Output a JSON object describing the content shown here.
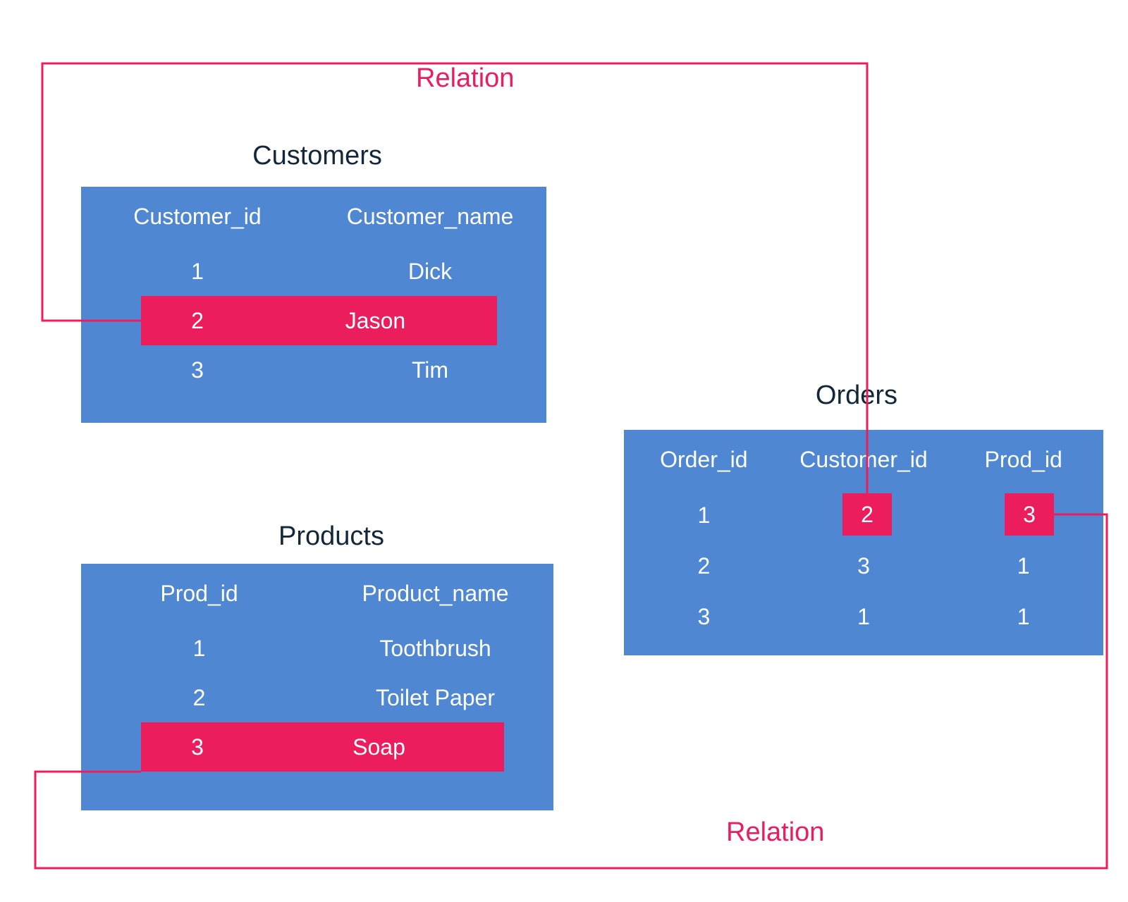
{
  "labels": {
    "relation_top": "Relation",
    "relation_bottom": "Relation"
  },
  "tables": {
    "customers": {
      "title": "Customers",
      "headers": [
        "Customer_id",
        "Customer_name"
      ],
      "rows": [
        {
          "id": "1",
          "name": "Dick"
        },
        {
          "id": "2",
          "name": "Jason"
        },
        {
          "id": "3",
          "name": "Tim"
        }
      ],
      "highlight_row_index": 1
    },
    "products": {
      "title": "Products",
      "headers": [
        "Prod_id",
        "Product_name"
      ],
      "rows": [
        {
          "id": "1",
          "name": "Toothbrush"
        },
        {
          "id": "2",
          "name": "Toilet Paper"
        },
        {
          "id": "3",
          "name": "Soap"
        }
      ],
      "highlight_row_index": 2
    },
    "orders": {
      "title": "Orders",
      "headers": [
        "Order_id",
        "Customer_id",
        "Prod_id"
      ],
      "rows": [
        {
          "order_id": "1",
          "customer_id": "2",
          "prod_id": "3"
        },
        {
          "order_id": "2",
          "customer_id": "3",
          "prod_id": "1"
        },
        {
          "order_id": "3",
          "customer_id": "1",
          "prod_id": "1"
        }
      ],
      "highlight_cells": {
        "first_row_customer_id": "2",
        "first_row_prod_id": "3"
      }
    }
  },
  "colors": {
    "table_bg": "#4f87d3",
    "highlight": "#ec1d5d",
    "title": "#12283a",
    "text_on_table": "#ffffff"
  }
}
